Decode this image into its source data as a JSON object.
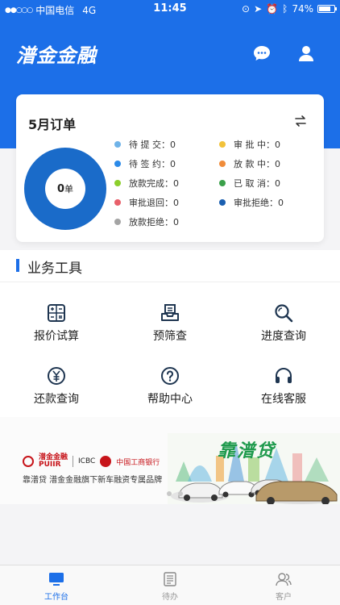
{
  "status_bar": {
    "signal_dots": "●●○○○",
    "carrier": "中国电信",
    "network": "4G",
    "time": "11:45",
    "battery": "74%"
  },
  "header": {
    "app_title": "潽金金融",
    "icons": [
      "chat-icon",
      "user-icon"
    ],
    "accent_color": "#1c6fe8"
  },
  "order_card": {
    "title": "5月订单",
    "total": "0",
    "unit": "单",
    "legend_left": [
      {
        "label": "待 提 交：0",
        "color": "#6fb3e8"
      },
      {
        "label": "待 签 约：0",
        "color": "#2b8ae8"
      },
      {
        "label": "放款完成：0",
        "color": "#8ccf2b"
      },
      {
        "label": "审批退回：0",
        "color": "#e8606a"
      },
      {
        "label": "放款拒绝：0",
        "color": "#a4a4a4"
      }
    ],
    "legend_right": [
      {
        "label": "审 批 中：0",
        "color": "#f2c23a"
      },
      {
        "label": "放 款 中：0",
        "color": "#f08c3a"
      },
      {
        "label": "已 取 消：0",
        "color": "#3aa04a"
      },
      {
        "label": "审批拒绝：0",
        "color": "#1a5fb0"
      }
    ]
  },
  "tools": {
    "title": "业务工具",
    "items": [
      {
        "label": "报价试算",
        "icon": "calculator-icon"
      },
      {
        "label": "预筛查",
        "icon": "inbox-icon"
      },
      {
        "label": "进度查询",
        "icon": "search-icon"
      },
      {
        "label": "还款查询",
        "icon": "yuan-icon"
      },
      {
        "label": "帮助中心",
        "icon": "help-icon"
      },
      {
        "label": "在线客服",
        "icon": "headset-icon"
      }
    ]
  },
  "banner": {
    "brand": "潽金金融",
    "brand_en": "PUIIR",
    "icbc": "ICBC",
    "icbc_name": "中国工商银行",
    "slogan": "靠潽贷  潽金金融旗下新车融资专属品牌",
    "headline": "靠潽贷"
  },
  "tabbar": {
    "items": [
      {
        "label": "工作台",
        "icon": "monitor-icon",
        "active": true
      },
      {
        "label": "待办",
        "icon": "document-icon",
        "active": false
      },
      {
        "label": "客户",
        "icon": "customers-icon",
        "active": false
      }
    ]
  }
}
